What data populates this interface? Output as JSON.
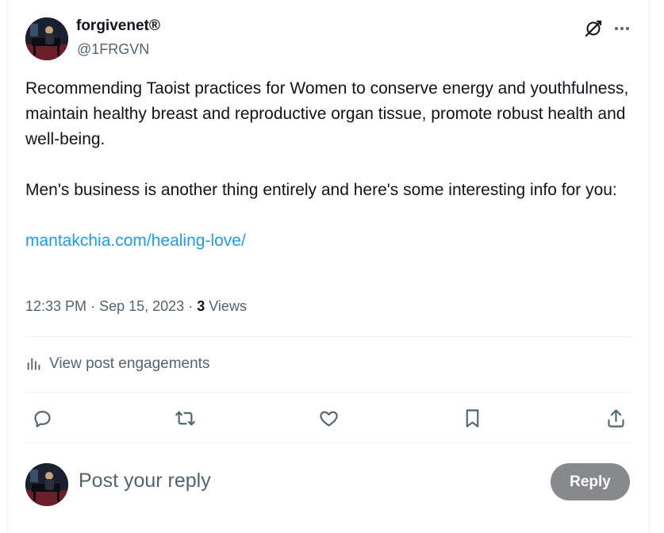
{
  "post": {
    "author": {
      "display_name": "forgivenet®",
      "handle": "@1FRGVN"
    },
    "paragraphs": [
      "Recommending Taoist practices for Women to conserve energy and youthfulness, maintain healthy breast and reproductive organ tissue, promote robust health and well-being.",
      "Men's business is another thing entirely and here's some interesting info for you:"
    ],
    "link": "mantakchia.com/healing-love/",
    "time": "12:33 PM",
    "date": "Sep 15, 2023",
    "views_count": "3",
    "views_label": "Views",
    "separator": "·"
  },
  "engagements": {
    "label": "View post engagements"
  },
  "reply": {
    "placeholder": "Post your reply",
    "button_label": "Reply"
  },
  "icons": {
    "header": [
      "grok-icon",
      "more-icon"
    ],
    "actions": [
      "reply-icon",
      "repost-icon",
      "like-icon",
      "bookmark-icon",
      "share-icon"
    ],
    "engagements": "analytics-icon"
  },
  "colors": {
    "text": "#0f1419",
    "muted": "#536471",
    "link": "#1d9bf0",
    "reply_button": "#87898c",
    "divider": "#eff3f4"
  }
}
